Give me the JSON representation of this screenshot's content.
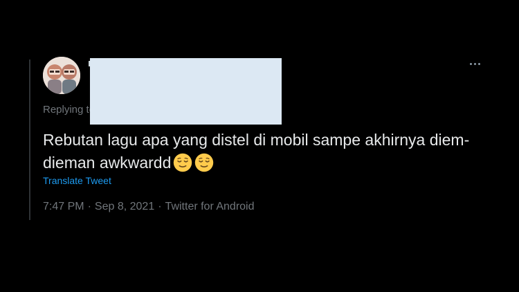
{
  "tweet": {
    "replying_label": "Replying to",
    "text": "Rebutan lagu apa yang distel di mobil sampe akhirnya diem-dieman awkwardd",
    "emojis": [
      "relieved-face",
      "relieved-face"
    ],
    "translate_label": "Translate Tweet",
    "time": "7:47 PM",
    "separator": "·",
    "date": "Sep 8, 2021",
    "source": "Twitter for Android"
  },
  "colors": {
    "background": "#000000",
    "text": "#e7e9ea",
    "muted": "#71767b",
    "link": "#1d9bf0",
    "redaction": "#dce8f3"
  }
}
